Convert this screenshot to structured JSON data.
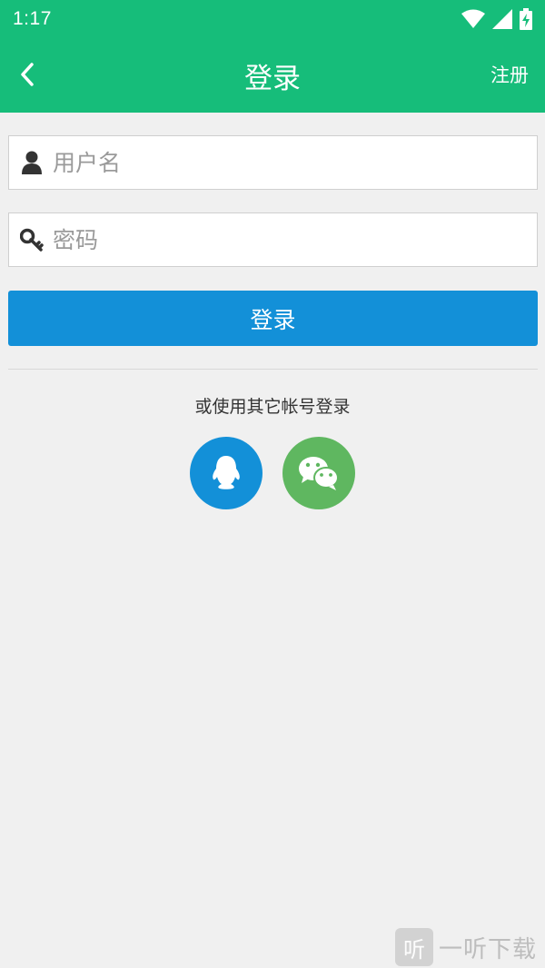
{
  "status_bar": {
    "time": "1:17",
    "icons": [
      "wifi-icon",
      "signal-icon",
      "battery-charging-icon"
    ]
  },
  "app_bar": {
    "title": "登录",
    "register_label": "注册",
    "back_icon": "chevron-left-icon",
    "color": "#16bd7a"
  },
  "form": {
    "username": {
      "value": "",
      "placeholder": "用户名",
      "icon": "user-icon"
    },
    "password": {
      "value": "",
      "placeholder": "密码",
      "icon": "key-icon"
    },
    "login_button_label": "登录",
    "login_button_color": "#1390d8"
  },
  "social": {
    "label": "或使用其它帐号登录",
    "providers": [
      {
        "name": "qq",
        "icon": "qq-penguin-icon",
        "color": "#1390d8"
      },
      {
        "name": "wechat",
        "icon": "wechat-icon",
        "color": "#5fb760"
      }
    ]
  },
  "watermark": {
    "logo_char": "听",
    "text": "一听下载"
  }
}
